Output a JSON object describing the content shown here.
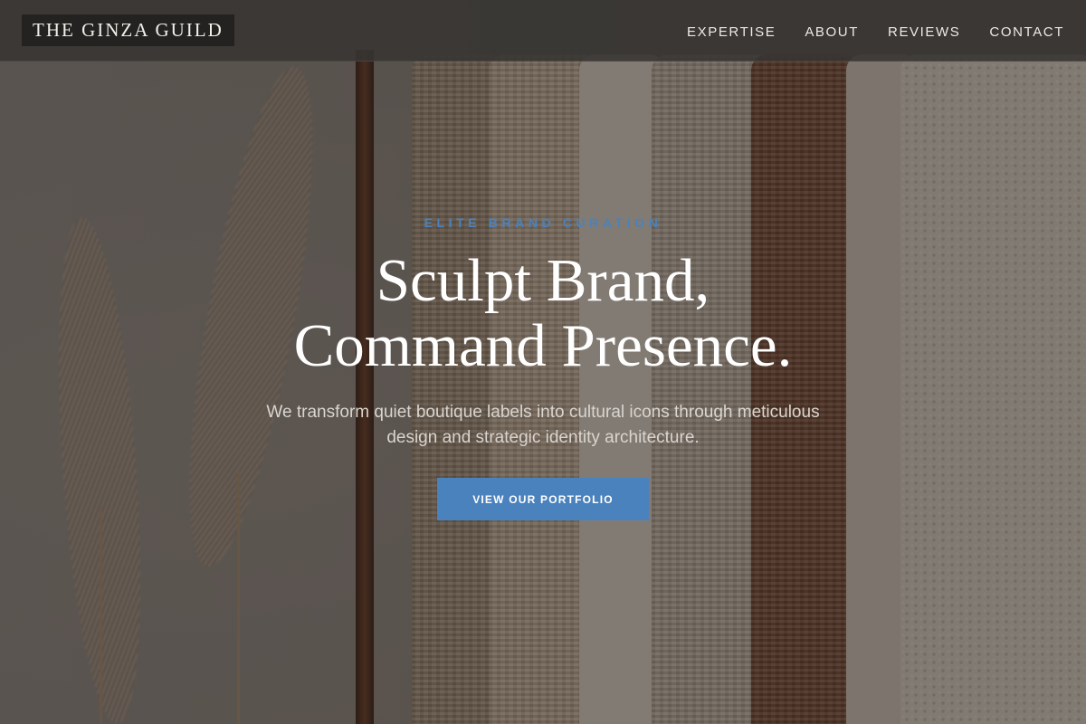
{
  "brand": {
    "logo_text": "THE GINZA GUILD"
  },
  "nav": {
    "items": [
      {
        "label": "EXPERTISE"
      },
      {
        "label": "ABOUT"
      },
      {
        "label": "REVIEWS"
      },
      {
        "label": "CONTACT"
      }
    ]
  },
  "hero": {
    "eyebrow": "ELITE BRAND CURATION",
    "headline_line1": "Sculpt Brand,",
    "headline_line2": "Command Presence.",
    "subhead": "We transform quiet boutique labels into cultural icons through meticulous design and strategic identity architecture.",
    "cta_label": "VIEW OUR PORTFOLIO"
  },
  "colors": {
    "accent": "#4a82bd",
    "navbar_bg": "#373432",
    "logo_bg": "#242221",
    "text_light": "#ffffff"
  }
}
